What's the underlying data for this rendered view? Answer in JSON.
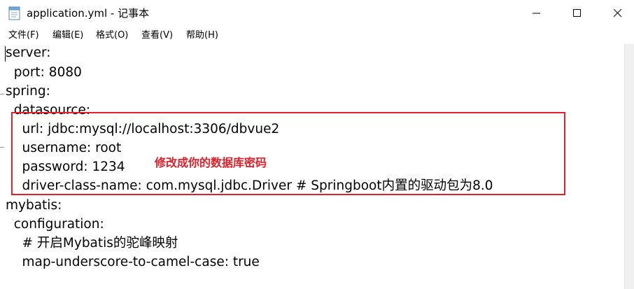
{
  "window": {
    "title": "application.yml - 记事本",
    "icon": "notepad-icon",
    "controls": [
      "minimize-icon",
      "maximize-icon",
      "close-icon"
    ]
  },
  "menu": {
    "items": [
      "文件(F)",
      "编辑(E)",
      "格式(O)",
      "查看(V)",
      "帮助(H)"
    ]
  },
  "editor": {
    "lines": [
      "server:",
      "  port: 8080",
      "spring:",
      "  datasource:",
      "    url: jdbc:mysql://localhost:3306/dbvue2",
      "    username: root",
      "    password: 1234",
      "    driver-class-name: com.mysql.jdbc.Driver # Springboot内置的驱动包为8.0",
      "mybatis:",
      "  configuration:",
      "    # 开启Mybatis的驼峰映射",
      "    map-underscore-to-camel-case: true"
    ]
  },
  "annotation": {
    "text": "修改成你的数据库密码",
    "color": "#e0202a"
  }
}
